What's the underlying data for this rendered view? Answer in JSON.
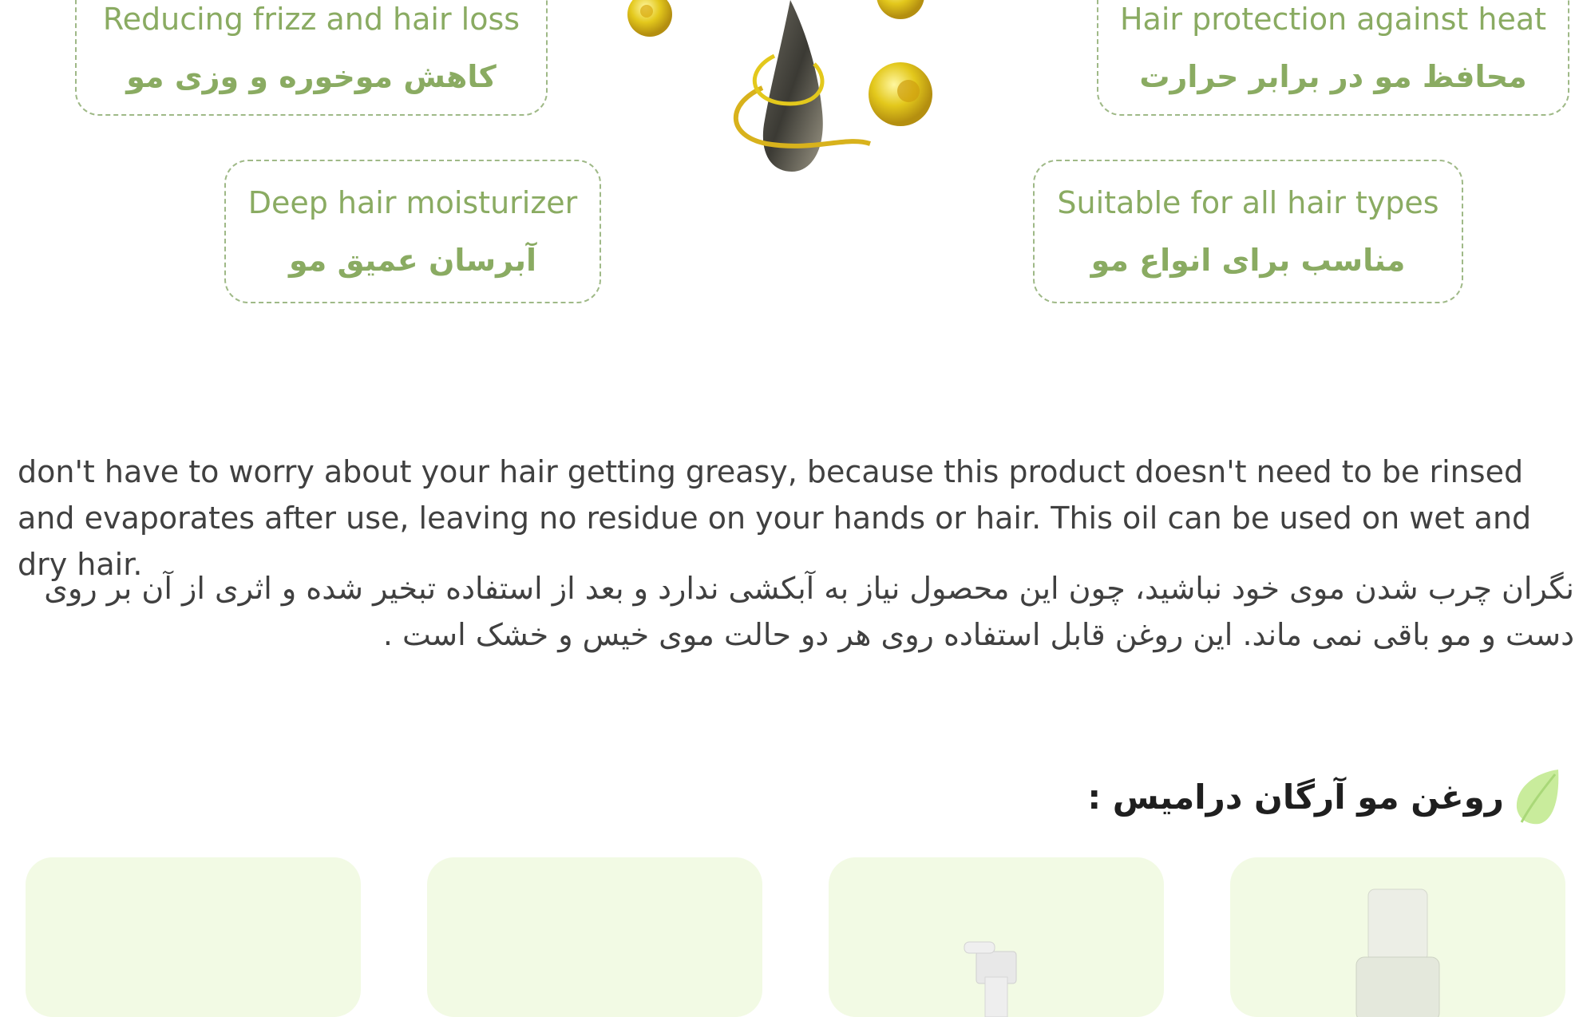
{
  "features": {
    "frizz": {
      "en": "Reducing frizz and hair loss",
      "fa": "کاهش موخوره و وزی مو"
    },
    "heat": {
      "en": "Hair protection against heat",
      "fa": "محافظ مو در برابر حرارت"
    },
    "moisturizer": {
      "en": "Deep hair moisturizer",
      "fa": "آبرسان عمیق مو"
    },
    "all_types": {
      "en": "Suitable for all hair types",
      "fa": "مناسب برای انواع مو"
    }
  },
  "description": {
    "en": "don't have to worry about your hair getting greasy, because this product doesn't need to be rinsed and evaporates after use, leaving no residue on your hands or hair. This oil can be used on  wet and dry hair.",
    "fa": "نگران چرب شدن موی خود نباشید، چون این محصول نیاز به آبکشی ندارد و بعد از استفاده تبخیر شده و اثری از آن بر روی دست و مو باقی نمی ماند. این روغن قابل استفاده روی هر دو حالت موی خیس و خشک است ."
  },
  "products_section": {
    "title": "روغن مو آرگان درامیس :",
    "icon": "leaf-icon"
  },
  "colors": {
    "accent": "#8aab62",
    "border": "#9fb987",
    "card_bg": "#f2fae4",
    "text": "#404040"
  }
}
